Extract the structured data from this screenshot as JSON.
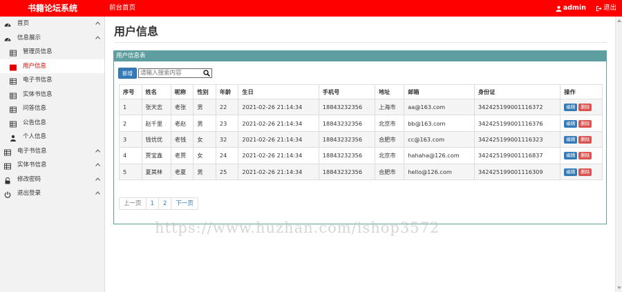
{
  "header": {
    "brand": "书籍论坛系统",
    "front_link": "前台首页",
    "user": "admin",
    "logout": "退出"
  },
  "sidebar": {
    "items": [
      {
        "label": "首页",
        "icon": "dashboard-icon",
        "level": 1,
        "chevron": "up"
      },
      {
        "label": "信息展示",
        "icon": "dashboard-icon",
        "level": 1,
        "chevron": "up"
      },
      {
        "label": "管理员信息",
        "icon": "table-icon",
        "level": 2
      },
      {
        "label": "用户信息",
        "icon": "table-icon",
        "level": 2,
        "active": true
      },
      {
        "label": "电子书信息",
        "icon": "table-icon",
        "level": 2
      },
      {
        "label": "实体书信息",
        "icon": "table-icon",
        "level": 2
      },
      {
        "label": "问答信息",
        "icon": "table-icon",
        "level": 2
      },
      {
        "label": "公告信息",
        "icon": "table-icon",
        "level": 2
      },
      {
        "label": "个人信息",
        "icon": "user-icon",
        "level": 2
      },
      {
        "label": "电子书信息",
        "icon": "table-icon",
        "level": 1,
        "chevron": "up"
      },
      {
        "label": "实体书信息",
        "icon": "table-icon",
        "level": 1,
        "chevron": "up"
      },
      {
        "label": "修改密码",
        "icon": "lock-icon",
        "level": 1,
        "chevron": "up"
      },
      {
        "label": "退出登录",
        "icon": "power-icon",
        "level": 1,
        "chevron": "up"
      }
    ]
  },
  "main": {
    "title": "用户信息",
    "panel_title": "用户信息表",
    "add_button": "新增",
    "search_placeholder": "请输入搜索内容",
    "columns": [
      "序号",
      "姓名",
      "昵称",
      "性别",
      "年龄",
      "生日",
      "手机号",
      "地址",
      "邮箱",
      "身份证",
      "操作"
    ],
    "rows": [
      [
        "1",
        "张天志",
        "老张",
        "男",
        "22",
        "2021-02-26 21:14:34",
        "18843232356",
        "上海市",
        "aa@163.com",
        "342425199001116372"
      ],
      [
        "2",
        "赵千里",
        "老赵",
        "男",
        "23",
        "2021-02-26 21:14:34",
        "18843232356",
        "北京市",
        "bb@163.com",
        "342425199001116376"
      ],
      [
        "3",
        "钱优优",
        "老钱",
        "女",
        "32",
        "2021-02-26 21:14:34",
        "18843232356",
        "合肥市",
        "cc@163.com",
        "342425199001116323"
      ],
      [
        "4",
        "贾宝鑫",
        "老贾",
        "女",
        "24",
        "2021-02-26 21:14:34",
        "18843232356",
        "北京市",
        "hahaha@126.com",
        "342425199001116837"
      ],
      [
        "5",
        "夏其林",
        "老夏",
        "男",
        "25",
        "2021-02-26 21:14:34",
        "18843232356",
        "合肥市",
        "hello@126.com",
        "342425199001116309"
      ]
    ],
    "edit_label": "编辑",
    "delete_label": "删除",
    "pager": [
      "上一页",
      "1",
      "2",
      "下一页"
    ]
  },
  "watermark": "https://www.huzhan.com/ishop3572",
  "colors": {
    "topbar": "#ff0000",
    "active_nav": "#e00000",
    "panel_head": "#5f9ea0",
    "primary": "#337ab7",
    "danger": "#d9534f"
  }
}
